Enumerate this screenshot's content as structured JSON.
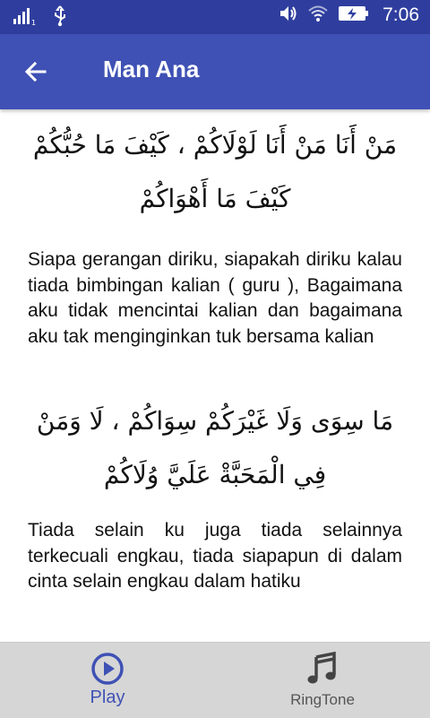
{
  "status_bar": {
    "time": "7:06",
    "icons": [
      "signal-icon",
      "usb-icon",
      "volume-icon",
      "wifi-icon",
      "battery-charging-icon"
    ]
  },
  "app_bar": {
    "title": "Man Ana",
    "back_icon": "arrow-left-icon"
  },
  "content": {
    "verse1_arabic": "مَنْ أَنَا مَنْ أَنَا لَوْلَاكُمْ ، كَيْفَ مَا حُبُّكُمْ كَيْفَ مَا أَهْوَاكُمْ",
    "verse1_translation": "Siapa gerangan diriku, siapakah diriku kalau tiada bimbingan kalian ( guru ), Bagaimana aku tidak mencintai kalian dan bagaimana aku tak menginginkan tuk bersama kalian",
    "verse2_arabic": "مَا سِوَى وَلَا غَيْرَكُمْ سِوَاكُمْ ، لَا وَمَنْ فِي الْمَحَبَّةْ عَلَيَّ وُلَاكُمْ",
    "verse2_translation": "Tiada selain ku juga tiada selainnya terkecuali engkau, tiada siapapun di dalam cinta selain engkau dalam hatiku"
  },
  "bottom_nav": {
    "items": [
      {
        "label": "Play",
        "icon": "play-circle-icon",
        "active": true
      },
      {
        "label": "RingTone",
        "icon": "music-note-icon",
        "active": false
      }
    ]
  },
  "colors": {
    "status_bar": "#2f3e9e",
    "app_bar": "#3f51b5",
    "active_nav": "#3f51b5",
    "bottom_nav_bg": "#d6d6d6"
  }
}
